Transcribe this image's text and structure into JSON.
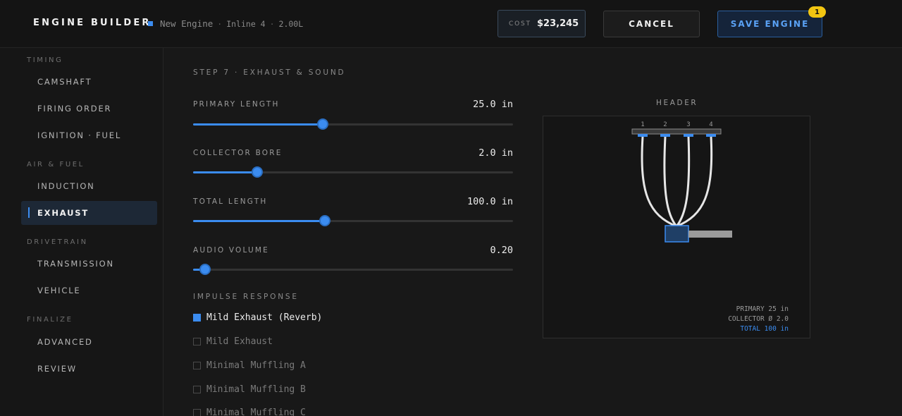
{
  "header": {
    "app_title": "ENGINE BUILDER",
    "engine_name": "New Engine",
    "engine_layout": "Inline 4",
    "displacement": "2.00L",
    "cost_label": "COST",
    "cost_value": "$23,245",
    "cancel_label": "CANCEL",
    "save_label": "SAVE ENGINE",
    "save_badge": "1"
  },
  "sidebar": {
    "sections": [
      {
        "label": "TIMING",
        "items": [
          "CAMSHAFT",
          "FIRING ORDER",
          "IGNITION · FUEL"
        ]
      },
      {
        "label": "AIR & FUEL",
        "items": [
          "INDUCTION",
          "EXHAUST"
        ]
      },
      {
        "label": "DRIVETRAIN",
        "items": [
          "TRANSMISSION",
          "VEHICLE"
        ]
      },
      {
        "label": "FINALIZE",
        "items": [
          "ADVANCED",
          "REVIEW"
        ]
      }
    ],
    "active_item": "EXHAUST"
  },
  "main": {
    "step_title": "STEP 7 · EXHAUST & SOUND",
    "params": [
      {
        "label": "PRIMARY LENGTH",
        "value": "25.0 in",
        "fraction": 0.405
      },
      {
        "label": "COLLECTOR BORE",
        "value": "2.0 in",
        "fraction": 0.2
      },
      {
        "label": "TOTAL LENGTH",
        "value": "100.0 in",
        "fraction": 0.411
      },
      {
        "label": "AUDIO VOLUME",
        "value": "0.20",
        "fraction": 0.038
      }
    ],
    "impulse_label": "IMPULSE RESPONSE",
    "impulse_options": [
      {
        "label": "Mild Exhaust (Reverb)",
        "checked": true
      },
      {
        "label": "Mild Exhaust",
        "checked": false
      },
      {
        "label": "Minimal Muffling A",
        "checked": false
      },
      {
        "label": "Minimal Muffling B",
        "checked": false
      },
      {
        "label": "Minimal Muffling C",
        "checked": false
      }
    ]
  },
  "diagram": {
    "title": "HEADER",
    "cylinders": [
      "1",
      "2",
      "3",
      "4"
    ],
    "readout_primary": "PRIMARY 25 in",
    "readout_collector": "COLLECTOR Ø 2.0",
    "readout_total": "TOTAL 100 in"
  },
  "colors": {
    "accent": "#3b8cf0",
    "badge": "#f2c511",
    "background": "#181818"
  }
}
